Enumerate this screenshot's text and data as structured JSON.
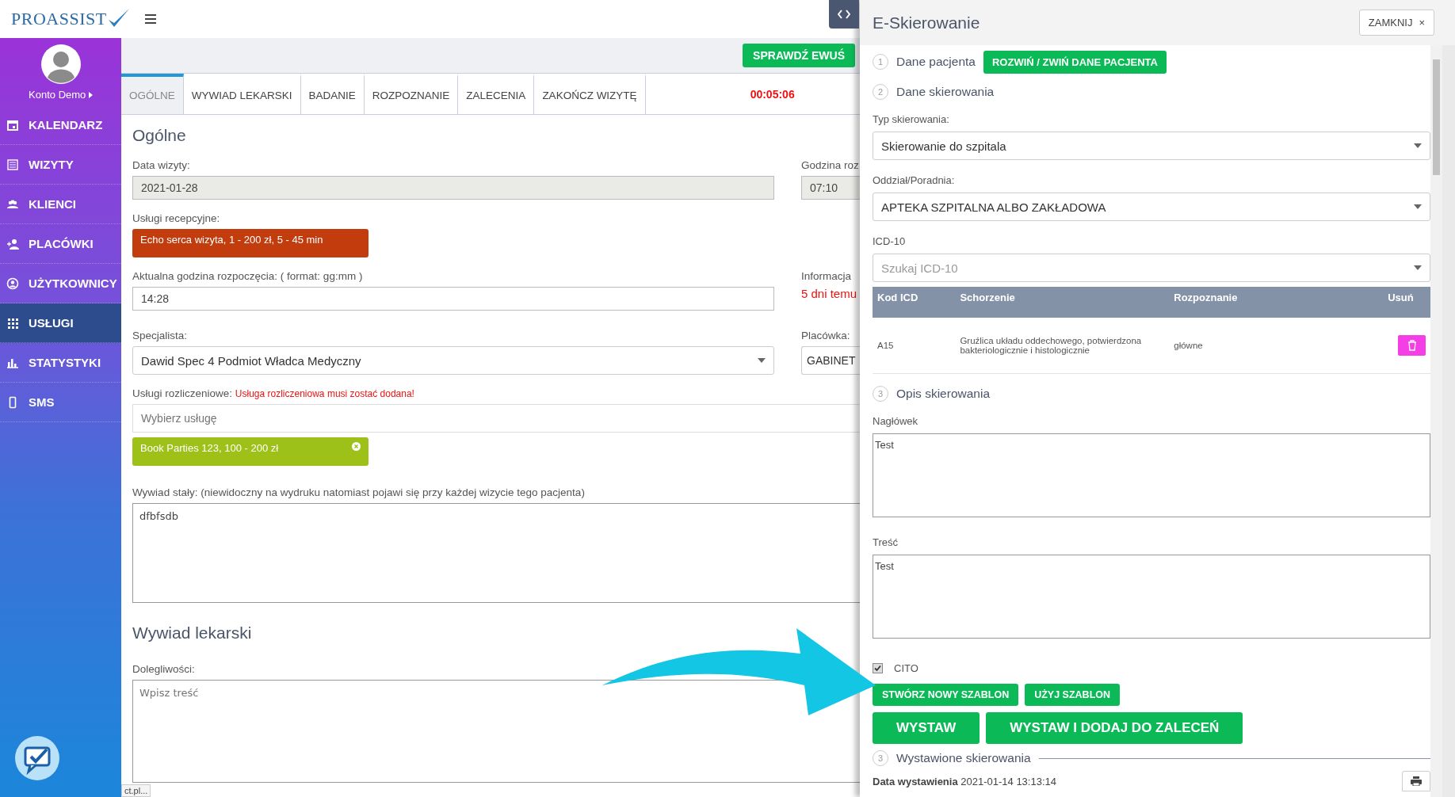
{
  "header": {
    "logo": "PROASSIST"
  },
  "sidebar": {
    "user": "Konto Demo",
    "items": [
      {
        "label": "KALENDARZ",
        "selected": false
      },
      {
        "label": "WIZYTY",
        "selected": false
      },
      {
        "label": "KLIENCI",
        "selected": false
      },
      {
        "label": "PLACÓWKI",
        "selected": false
      },
      {
        "label": "UŻYTKOWNICY",
        "selected": false
      },
      {
        "label": "USŁUGI",
        "selected": true
      },
      {
        "label": "STATYSTYKI",
        "selected": false
      },
      {
        "label": "SMS",
        "selected": false
      }
    ]
  },
  "toolbar": {
    "ewus_button": "SPRAWDŹ EWUŚ"
  },
  "tabs": [
    {
      "label": "OGÓLNE",
      "selected": true
    },
    {
      "label": "WYWIAD LEKARSKI",
      "selected": false
    },
    {
      "label": "BADANIE",
      "selected": false
    },
    {
      "label": "ROZPOZNANIE",
      "selected": false
    },
    {
      "label": "ZALECENIA",
      "selected": false
    },
    {
      "label": "ZAKOŃCZ WIZYTĘ",
      "selected": false
    }
  ],
  "timer": "00:05:06",
  "form": {
    "title": "Ogólne",
    "visit_date": {
      "label": "Data wizyty:",
      "value": "2021-01-28"
    },
    "visit_time": {
      "label": "Godzina roz",
      "value": "07:10"
    },
    "reception": {
      "label": "Usługi recepcyjne:",
      "chip": "Echo serca wizyta, 1 - 200 zł, 5 - 45 min",
      "color": "#c33c0e"
    },
    "start_time": {
      "label": "Aktualna godzina rozpoczęcia: ( format: gg:mm )",
      "value": "14:28"
    },
    "info": {
      "label": "Informacja",
      "value": "5 dni temu"
    },
    "specialist": {
      "label": "Specjalista:",
      "value": "Dawid Spec 4 Podmiot Władca Medyczny"
    },
    "clinic": {
      "label": "Placówka:",
      "value": "GABINET"
    },
    "billing": {
      "label": "Usługi rozliczeniowe:",
      "warning": "Usługa rozliczeniowa musi zostać dodana!",
      "placeholder": "Wybierz usługę",
      "chip": "Book Parties 123, 100 - 200 zł",
      "color": "#9dc118"
    },
    "permanent_interview": {
      "label": "Wywiad stały: (niewidoczny na wydruku natomiast pojawi się przy każdej wizycie tego pacjenta)",
      "value": "dfbfsdb"
    },
    "section": "Wywiad lekarski",
    "complaints": {
      "label": "Dolegliwości:",
      "placeholder": "Wpisz treść"
    }
  },
  "status_tooltip": "ct.pl...",
  "panel": {
    "title": "E-Skierowanie",
    "close": "ZAMKNIJ",
    "close_icon": "×",
    "step1": {
      "number": "1",
      "title": "Dane pacjenta",
      "button": "ROZWIŃ / ZWIŃ DANE PACJENTA"
    },
    "step2": {
      "number": "2",
      "title": "Dane skierowania"
    },
    "referral_type": {
      "label": "Typ skierowania:",
      "value": "Skierowanie do szpitala"
    },
    "department": {
      "label": "Oddział/Poradnia:",
      "value": "APTEKA SZPITALNA ALBO ZAKŁADOWA"
    },
    "icd": {
      "label": "ICD-10",
      "placeholder": "Szukaj ICD-10"
    },
    "table": {
      "columns": [
        "Kod ICD",
        "Schorzenie",
        "Rozpoznanie",
        "Usuń"
      ],
      "rows": [
        {
          "code": "A15",
          "disease": "Gruźlica układu oddechowego, potwierdzona bakteriologicznie i histologicznie",
          "diagnosis": "główne"
        }
      ]
    },
    "step3": {
      "number": "3",
      "title": "Opis skierowania"
    },
    "heading": {
      "label": "Nagłówek",
      "value": "Test"
    },
    "content": {
      "label": "Treść",
      "value": "Test"
    },
    "cito": {
      "label": "CITO",
      "checked": true
    },
    "template_buttons": [
      "STWÓRZ NOWY SZABLON",
      "UŻYJ SZABLON"
    ],
    "issue_buttons": [
      "WYSTAW",
      "WYSTAW I DODAJ DO ZALECEŃ"
    ],
    "issued": {
      "number": "3",
      "title": "Wystawione skierowania",
      "date": "**Data wystawienia** 2021-01-14 13:13:14"
    }
  }
}
